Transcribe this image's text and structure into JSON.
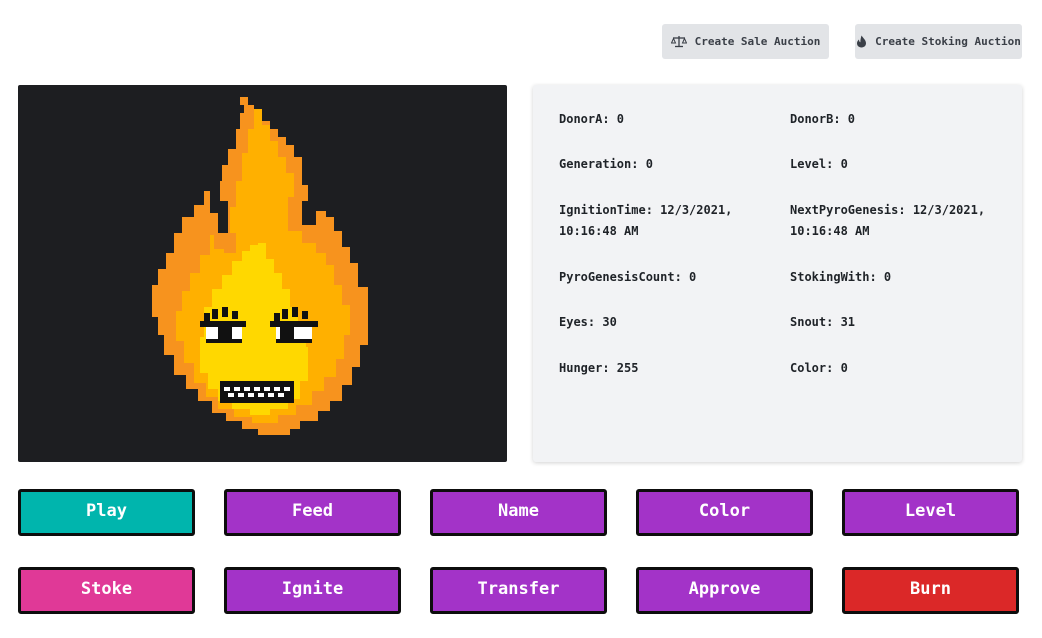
{
  "header": {
    "create_sale_auction": "Create Sale Auction",
    "create_stoking_auction": "Create Stoking Auction"
  },
  "icons": {
    "sale": "scale-icon",
    "stoking": "flame-icon"
  },
  "stats": {
    "donor_a": "DonorA: 0",
    "donor_b": "DonorB: 0",
    "generation": "Generation: 0",
    "level": "Level: 0",
    "ignition_time_1": "IgnitionTime: 12/3/2021,",
    "ignition_time_2": "10:16:48 AM",
    "next_pyrogenesis_1": "NextPyroGenesis: 12/3/2021,",
    "next_pyrogenesis_2": "10:16:48 AM",
    "pyrogenesis_count": "PyroGenesisCount: 0",
    "stoking_with": "StokingWith: 0",
    "eyes": "Eyes: 30",
    "snout": "Snout: 31",
    "hunger": "Hunger: 255",
    "color": "Color: 0"
  },
  "actions": {
    "play": "Play",
    "feed": "Feed",
    "name": "Name",
    "color": "Color",
    "level": "Level",
    "stoke": "Stoke",
    "ignite": "Ignite",
    "transfer": "Transfer",
    "approve": "Approve",
    "burn": "Burn"
  },
  "colors": {
    "play": "#00b5ad",
    "purple": "#a333c8",
    "stoke": "#e03997",
    "burn": "#db2828",
    "art_bg": "#1d1e21",
    "flame_outer": "#f7931e",
    "flame_mid": "#ffb000",
    "flame_inner": "#ffd800"
  }
}
